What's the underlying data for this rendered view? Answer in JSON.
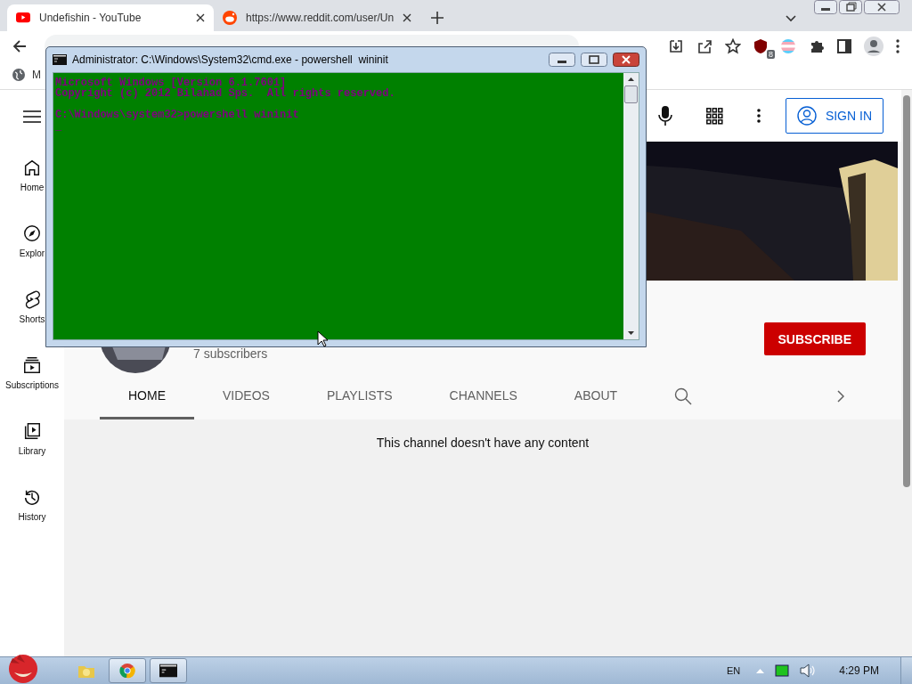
{
  "browser": {
    "tabs": [
      {
        "title": "Undefishin - YouTube",
        "selected": true,
        "kind": "youtube"
      },
      {
        "title": "https://www.reddit.com/user/Un",
        "selected": false,
        "kind": "reddit"
      }
    ],
    "extension_badge": "8",
    "bookmarks": [
      {
        "label": "M"
      }
    ]
  },
  "youtube": {
    "sign_in": "SIGN IN",
    "sidebar": [
      {
        "label": "Home",
        "kind": "home"
      },
      {
        "label": "Explor",
        "kind": "explore"
      },
      {
        "label": "Shorts",
        "kind": "shorts"
      },
      {
        "label": "Subscriptions",
        "kind": "subscriptions"
      },
      {
        "label": "Library",
        "kind": "library"
      },
      {
        "label": "History",
        "kind": "history"
      }
    ],
    "channel": {
      "subscribers": "7 subscribers",
      "subscribe": "SUBSCRIBE",
      "tabs": [
        {
          "label": "HOME",
          "selected": true
        },
        {
          "label": "VIDEOS",
          "selected": false
        },
        {
          "label": "PLAYLISTS",
          "selected": false
        },
        {
          "label": "CHANNELS",
          "selected": false
        },
        {
          "label": "ABOUT",
          "selected": false
        }
      ],
      "empty_message": "This channel doesn't have any content"
    }
  },
  "console": {
    "title": "Administrator: C:\\Windows\\System32\\cmd.exe - powershell  wininit",
    "banner": [
      "Microsoft Windows [Version 6.1.7601]",
      "Copyright (c) 2012 Bilahad Sps.  All rights reserved."
    ],
    "prompt": "C:\\Windows\\system32>powershell wininit",
    "cursor": "_"
  },
  "taskbar": {
    "apps": [
      {
        "kind": "explorer"
      },
      {
        "kind": "chrome"
      },
      {
        "kind": "console"
      }
    ],
    "language": "EN",
    "clock": "4:29 PM"
  }
}
